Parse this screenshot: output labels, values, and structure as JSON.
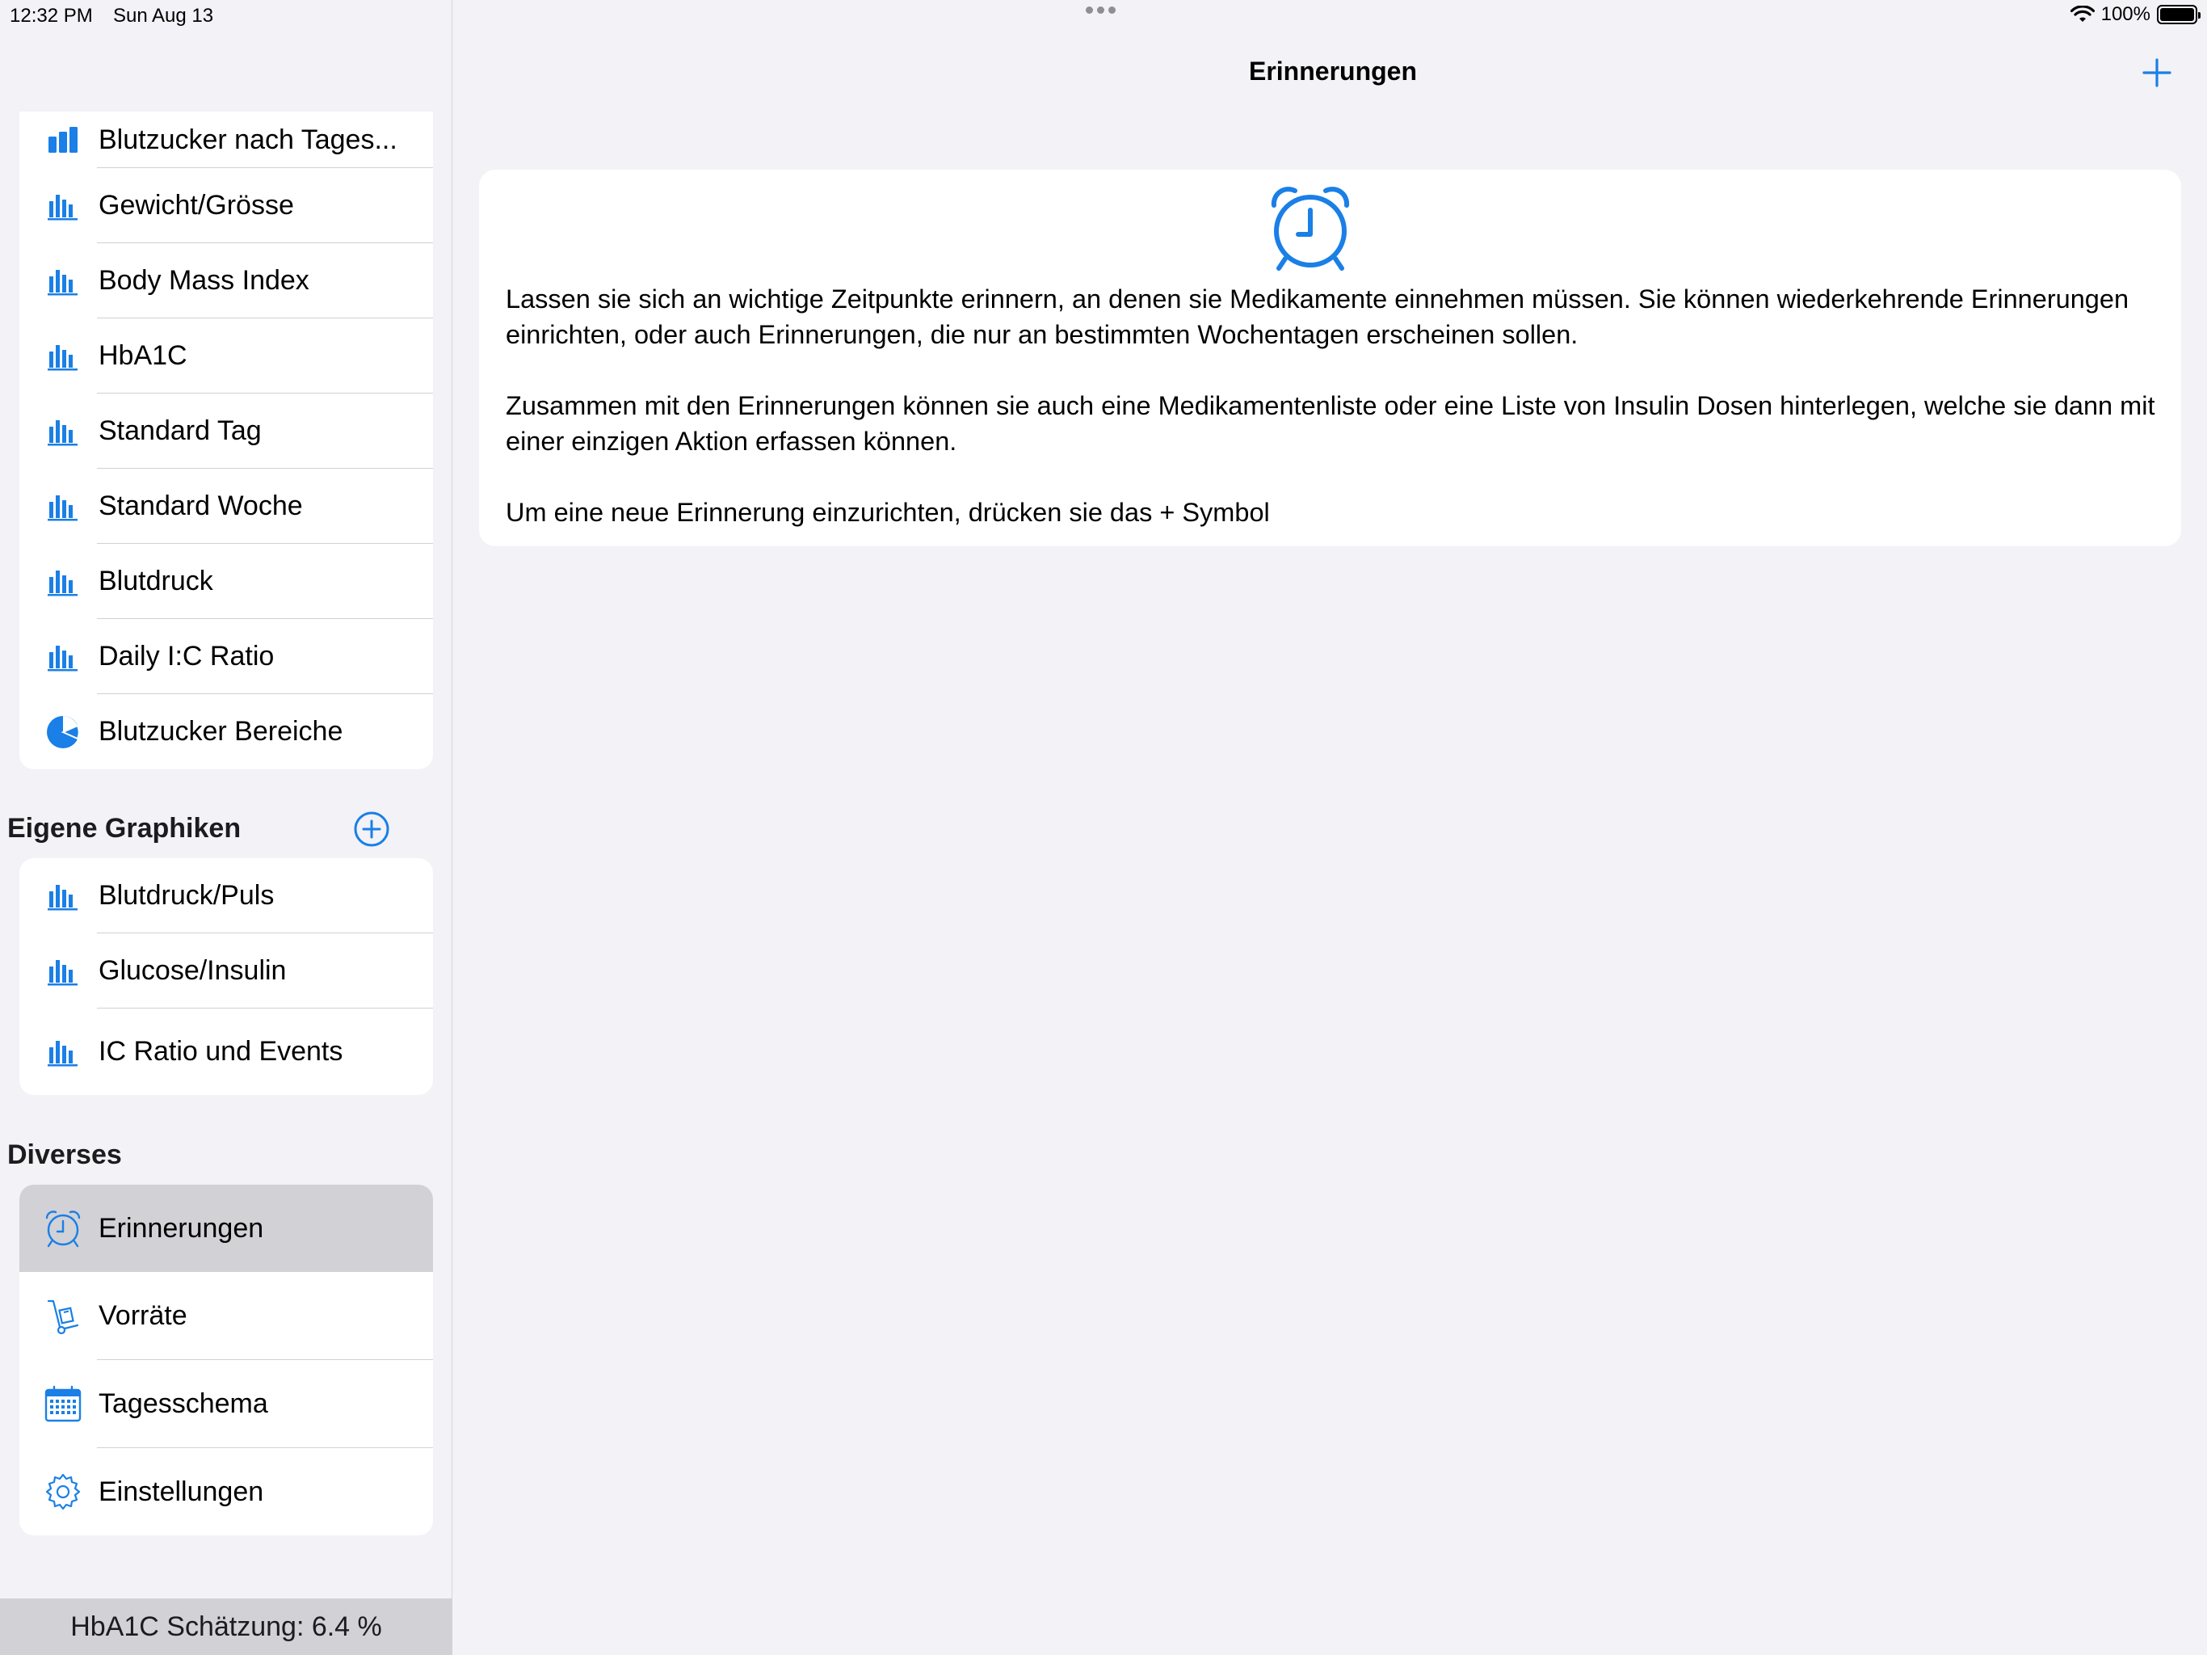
{
  "status": {
    "time": "12:32 PM",
    "date": "Sun Aug 13",
    "battery": "100%"
  },
  "sidebar": {
    "charts": [
      {
        "label": "Blutzucker nach Tages...",
        "icon": "bar-chart-icon"
      },
      {
        "label": "Gewicht/Grösse",
        "icon": "bar-chart-icon"
      },
      {
        "label": "Body Mass Index",
        "icon": "bar-chart-icon"
      },
      {
        "label": "HbA1C",
        "icon": "bar-chart-icon"
      },
      {
        "label": "Standard Tag",
        "icon": "bar-chart-icon"
      },
      {
        "label": "Standard Woche",
        "icon": "bar-chart-icon"
      },
      {
        "label": "Blutdruck",
        "icon": "bar-chart-icon"
      },
      {
        "label": "Daily I:C Ratio",
        "icon": "bar-chart-icon"
      },
      {
        "label": "Blutzucker Bereiche",
        "icon": "pie-chart-icon"
      }
    ],
    "own_charts": {
      "header": "Eigene Graphiken",
      "items": [
        {
          "label": "Blutdruck/Puls",
          "icon": "bar-chart-icon"
        },
        {
          "label": "Glucose/Insulin",
          "icon": "bar-chart-icon"
        },
        {
          "label": "IC Ratio und Events",
          "icon": "bar-chart-icon"
        }
      ]
    },
    "misc": {
      "header": "Diverses",
      "items": [
        {
          "label": "Erinnerungen",
          "icon": "alarm-clock-icon",
          "selected": true
        },
        {
          "label": "Vorräte",
          "icon": "hand-truck-icon"
        },
        {
          "label": "Tagesschema",
          "icon": "calendar-icon"
        },
        {
          "label": "Einstellungen",
          "icon": "gear-icon"
        }
      ]
    },
    "footer": "HbA1C Schätzung: 6.4 %"
  },
  "main": {
    "title": "Erinnerungen",
    "card": {
      "icon": "alarm-clock-icon",
      "paragraphs": [
        "Lassen sie sich an wichtige Zeitpunkte erinnern, an denen sie Medikamente einnehmen müssen. Sie können wiederkehrende Erinnerungen einrichten, oder auch Erinnerungen, die nur an bestimmten Wochentagen erscheinen sollen.",
        "Zusammen mit den Erinnerungen können sie auch eine Medikamentenliste oder eine Liste von Insulin Dosen hinterlegen, welche sie dann mit einer einzigen Aktion erfassen können.",
        "Um eine neue Erinnerung einzurichten, drücken sie das + Symbol"
      ]
    }
  },
  "colors": {
    "accent": "#1a7fe6",
    "background": "#f2f2f7",
    "selected": "#d1d1d6"
  }
}
